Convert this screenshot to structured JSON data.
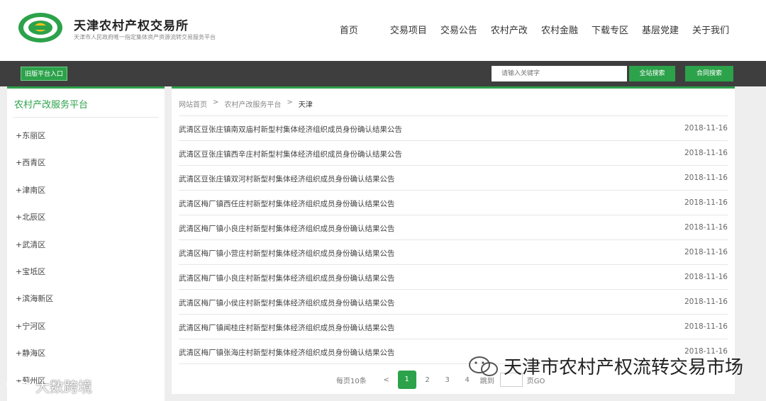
{
  "header": {
    "logo_icon": "green-ring-leaf-logo",
    "title": "天津农村产权交易所",
    "subtitle": "天津市人民政府唯一指定集体资产资源流转交易服务平台",
    "nav": [
      "首页",
      "交易项目",
      "交易公告",
      "农村产改",
      "农村金融",
      "下载专区",
      "基层党建",
      "关于我们"
    ]
  },
  "bar": {
    "old_entry": "旧版平台入口",
    "search_placeholder": "请输入关键字",
    "site_search": "全站搜索",
    "web_search": "合同搜索"
  },
  "sidebar": {
    "title": "农村产改服务平台",
    "items": [
      "+东丽区",
      "+西青区",
      "+津南区",
      "+北辰区",
      "+武清区",
      "+宝坻区",
      "+滨海新区",
      "+宁河区",
      "+静海区",
      "+蓟州区"
    ]
  },
  "breadcrumb": {
    "home": "网站首页",
    "sep": ">",
    "section": "农村产改服务平台",
    "current": "天津"
  },
  "notices": [
    {
      "title": "武清区豆张庄镇南双庙村新型村集体经济组织成员身份确认结果公告",
      "date": "2018-11-16"
    },
    {
      "title": "武清区豆张庄镇西辛庄村新型村集体经济组织成员身份确认结果公告",
      "date": "2018-11-16"
    },
    {
      "title": "武清区豆张庄镇双河村新型村集体经济组织成员身份确认结果公告",
      "date": "2018-11-16"
    },
    {
      "title": "武清区梅厂镇西任庄村新型村集体经济组织成员身份确认结果公告",
      "date": "2018-11-16"
    },
    {
      "title": "武清区梅厂镇小良庄村新型村集体经济组织成员身份确认结果公告",
      "date": "2018-11-16"
    },
    {
      "title": "武清区梅厂镇小营庄村新型村集体经济组织成员身份确认结果公告",
      "date": "2018-11-16"
    },
    {
      "title": "武清区梅厂镇小良庄村新型村集体经济组织成员身份确认结果公告",
      "date": "2018-11-16"
    },
    {
      "title": "武清区梅厂镇小侯庄村新型村集体经济组织成员身份确认结果公告",
      "date": "2018-11-16"
    },
    {
      "title": "武清区梅厂镇闻桂庄村新型村集体经济组织成员身份确认结果公告",
      "date": "2018-11-16"
    },
    {
      "title": "武清区梅厂镇张海庄村新型村集体经济组织成员身份确认结果公告",
      "date": "2018-11-16"
    }
  ],
  "pagination": {
    "per_page": "每页10条",
    "prev": "<",
    "pages": [
      "1",
      "2",
      "3",
      "4"
    ],
    "active": "1",
    "jump_label": "跳到",
    "go_label": "页GO"
  },
  "watermarks": {
    "right_text": "天津市农村产权流转交易市场",
    "left_text": "大数跨境",
    "wechat_icon": "wechat-icon"
  },
  "colors": {
    "accent": "#2ca24a",
    "bar": "#3e3e3e",
    "background": "#eeeeee"
  }
}
